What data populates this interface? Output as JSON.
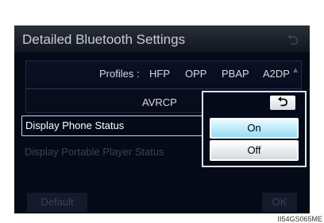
{
  "header": {
    "title": "Detailed Bluetooth Settings",
    "back_icon": "back-arrow-icon"
  },
  "profiles": {
    "label": "Profiles :",
    "items": [
      "HFP",
      "OPP",
      "PBAP",
      "A2DP",
      "AVRCP"
    ],
    "scroll_icon": "scroll-up-icon"
  },
  "settings": {
    "display_phone_status": "Display Phone Status",
    "display_portable_player_status": "Display Portable Player Status"
  },
  "popup": {
    "back_icon": "return-arrow-icon",
    "options": [
      "On",
      "Off"
    ],
    "selected": "On"
  },
  "footer": {
    "default_label": "Default",
    "ok_label": "OK"
  },
  "image_code": "II54GS065ME",
  "colors": {
    "selected_option": "#98dcf7",
    "screen_bg": "#050a18"
  }
}
